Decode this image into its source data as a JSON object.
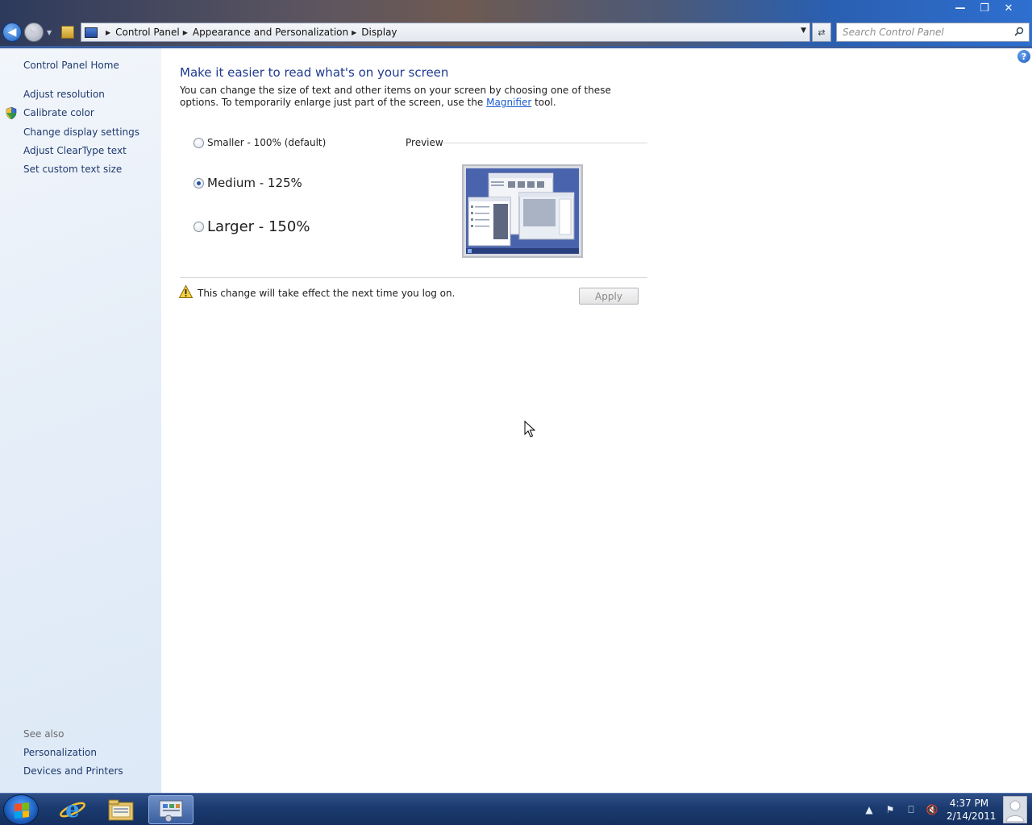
{
  "window": {
    "minimize_label": "—",
    "restore_label": "❐",
    "close_label": "✕"
  },
  "address": {
    "crumbs": [
      "Control Panel",
      "Appearance and Personalization",
      "Display"
    ],
    "search_placeholder": "Search Control Panel"
  },
  "sidebar": {
    "home": "Control Panel Home",
    "items": [
      {
        "label": "Adjust resolution",
        "icon": null
      },
      {
        "label": "Calibrate color",
        "icon": "uac-shield-icon"
      },
      {
        "label": "Change display settings",
        "icon": null
      },
      {
        "label": "Adjust ClearType text",
        "icon": null
      },
      {
        "label": "Set custom text size",
        "icon": null
      }
    ],
    "see_also_heading": "See also",
    "see_also": [
      "Personalization",
      "Devices and Printers"
    ]
  },
  "main": {
    "title": "Make it easier to read what's on your screen",
    "desc_part1": "You can change the size of text and other items on your screen by choosing one of these options. To temporarily enlarge just part of the screen, use the ",
    "magnifier_link": "Magnifier",
    "desc_part2": " tool.",
    "options": [
      {
        "label": "Smaller - 100% (default)",
        "selected": false
      },
      {
        "label": "Medium - 125%",
        "selected": true
      },
      {
        "label": "Larger - 150%",
        "selected": false
      }
    ],
    "preview_label": "Preview",
    "warning": "This change will take effect the next time you log on.",
    "apply_label": "Apply"
  },
  "taskbar": {
    "time": "4:37 PM",
    "date": "2/14/2011",
    "apps": [
      "internet-explorer-icon",
      "windows-explorer-icon",
      "control-panel-icon"
    ]
  },
  "colors": {
    "link": "#1e3a6e",
    "title": "#1e3a8f",
    "accent": "#1a5bd0"
  }
}
